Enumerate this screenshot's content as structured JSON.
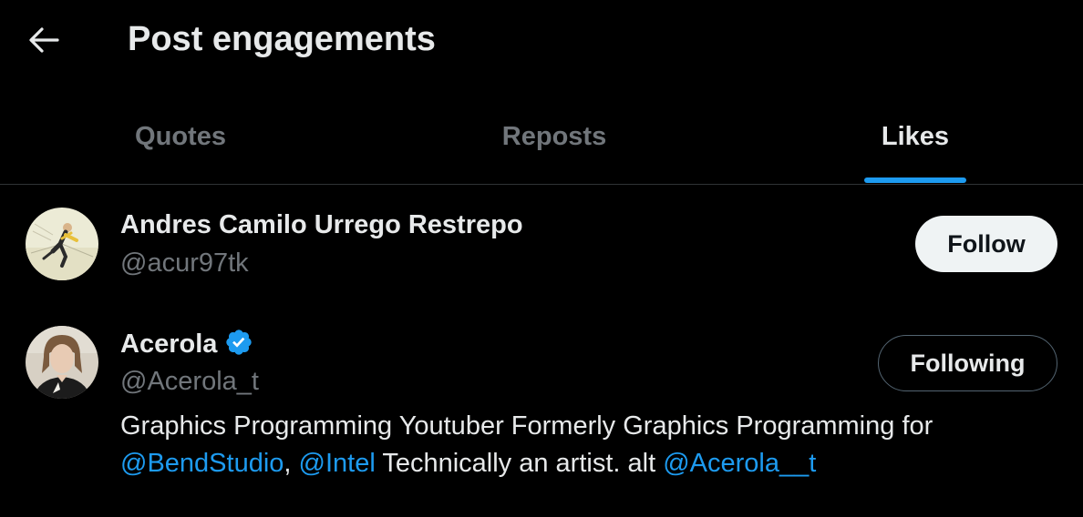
{
  "header": {
    "title": "Post engagements",
    "back_icon": "arrow-left-icon"
  },
  "tabs": [
    {
      "label": "Quotes",
      "active": false
    },
    {
      "label": "Reposts",
      "active": false
    },
    {
      "label": "Likes",
      "active": true
    }
  ],
  "users": [
    {
      "name": "Andres Camilo Urrego Restrepo",
      "handle": "@acur97tk",
      "verified": false,
      "button": "Follow",
      "avatar_icon": "avatar-figure-icon"
    },
    {
      "name": "Acerola",
      "handle": "@Acerola_t",
      "verified": true,
      "button": "Following",
      "avatar_icon": "avatar-portrait-icon",
      "bio": {
        "text_1": "Graphics Programming Youtuber Formerly Graphics Programming for",
        "mention_1": "@BendStudio",
        "sep_1": ",",
        "mention_2": "@Intel",
        "text_2": "Technically an artist. alt",
        "mention_3": "@Acerola__t"
      }
    }
  ],
  "colors": {
    "background": "#000000",
    "text_primary": "#e7e9ea",
    "text_secondary": "#71767b",
    "accent": "#1d9bf0",
    "divider": "#2f3336",
    "follow_bg": "#eff3f4"
  }
}
